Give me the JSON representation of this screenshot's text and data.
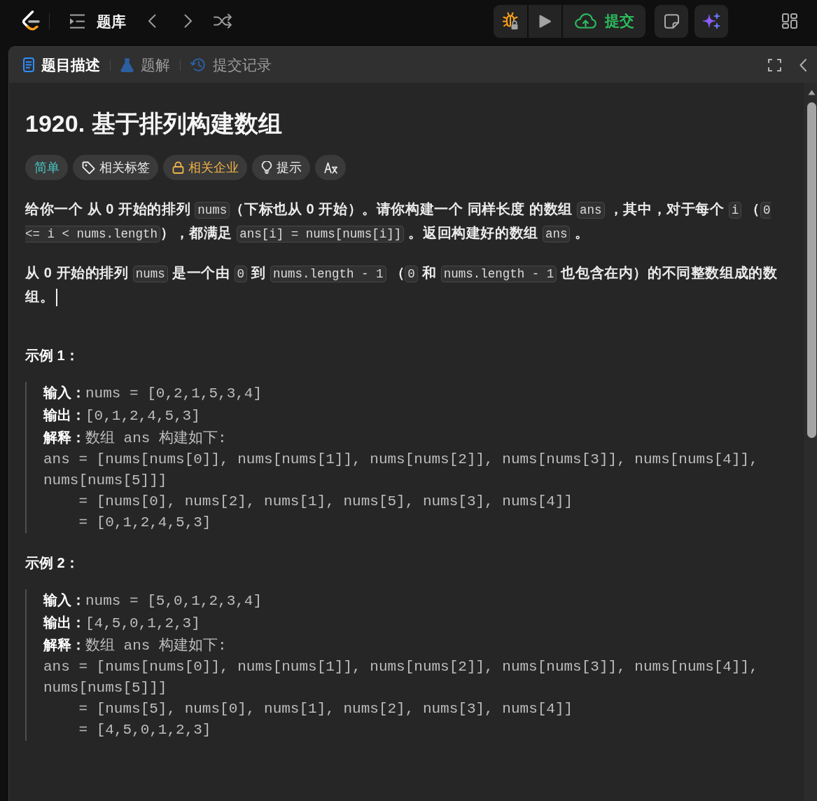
{
  "top_bar": {
    "title": "题库",
    "submit_label": "提交"
  },
  "panel": {
    "tabs": [
      {
        "kind": "description",
        "label": "题目描述",
        "selected": true
      },
      {
        "kind": "solutions",
        "label": "题解",
        "selected": false
      },
      {
        "kind": "submissions",
        "label": "提交记录",
        "selected": false
      }
    ]
  },
  "problem": {
    "title": "1920. 基于排列构建数组",
    "tags": [
      {
        "kind": "difficulty",
        "label": "简单"
      },
      {
        "kind": "topics",
        "label": "相关标签"
      },
      {
        "kind": "companies",
        "label": "相关企业"
      },
      {
        "kind": "hint",
        "label": "提示"
      },
      {
        "kind": "translate"
      }
    ],
    "description": [
      {
        "caret": false,
        "segments": [
          {
            "kind": "text",
            "text": "给你一个 从 0 开始的排列 "
          },
          {
            "kind": "code",
            "text": "nums"
          },
          {
            "kind": "text",
            "text": "（下标也从 0 开始）。请你构建一个 同样长度 的数组 "
          },
          {
            "kind": "code",
            "text": "ans"
          },
          {
            "kind": "text",
            "text": " ，其中，对于每个 "
          },
          {
            "kind": "code",
            "text": "i"
          },
          {
            "kind": "text",
            "text": " （"
          },
          {
            "kind": "code",
            "text": "0 <= i < nums.length"
          },
          {
            "kind": "text",
            "text": "），都满足 "
          },
          {
            "kind": "code",
            "text": "ans[i] = nums[nums[i]]"
          },
          {
            "kind": "text",
            "text": " 。返回构建好的数组 "
          },
          {
            "kind": "code",
            "text": "ans"
          },
          {
            "kind": "text",
            "text": " 。"
          }
        ]
      },
      {
        "caret": true,
        "segments": [
          {
            "kind": "text",
            "text": "从 0 开始的排列 "
          },
          {
            "kind": "code",
            "text": "nums"
          },
          {
            "kind": "text",
            "text": " 是一个由 "
          },
          {
            "kind": "code",
            "text": "0"
          },
          {
            "kind": "text",
            "text": " 到 "
          },
          {
            "kind": "code",
            "text": "nums.length - 1"
          },
          {
            "kind": "text",
            "text": " （"
          },
          {
            "kind": "code",
            "text": "0"
          },
          {
            "kind": "text",
            "text": " 和 "
          },
          {
            "kind": "code",
            "text": "nums.length - 1"
          },
          {
            "kind": "text",
            "text": " 也包含在内）的不同整数组成的数组。"
          }
        ]
      }
    ],
    "examples": [
      {
        "title": "示例 1：",
        "lines": [
          {
            "label": "输入：",
            "text": "nums = [0,2,1,5,3,4]"
          },
          {
            "label": "输出：",
            "text": "[0,1,2,4,5,3]"
          },
          {
            "label": "解释：",
            "text": "数组 ans 构建如下:"
          },
          {
            "text": "ans = [nums[nums[0]], nums[nums[1]], nums[nums[2]], nums[nums[3]], nums[nums[4]], nums[nums[5]]]"
          },
          {
            "text": "    = [nums[0], nums[2], nums[1], nums[5], nums[3], nums[4]]"
          },
          {
            "text": "    = [0,1,2,4,5,3]"
          }
        ]
      },
      {
        "title": "示例 2：",
        "lines": [
          {
            "label": "输入：",
            "text": "nums = [5,0,1,2,3,4]"
          },
          {
            "label": "输出：",
            "text": "[4,5,0,1,2,3]"
          },
          {
            "label": "解释：",
            "text": "数组 ans 构建如下:"
          },
          {
            "text": "ans = [nums[nums[0]], nums[nums[1]], nums[nums[2]], nums[nums[3]], nums[nums[4]], nums[nums[5]]]"
          },
          {
            "text": "    = [nums[5], nums[0], nums[1], nums[2], nums[3], nums[4]]"
          },
          {
            "text": "    = [4,5,0,1,2,3]"
          }
        ]
      }
    ]
  }
}
